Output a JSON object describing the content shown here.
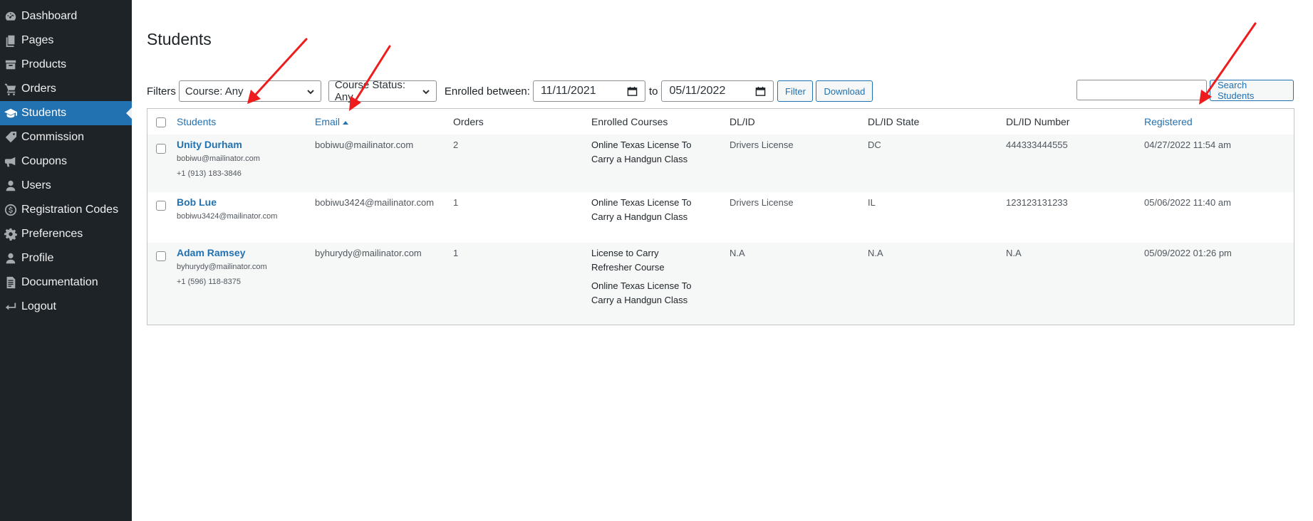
{
  "sidebar": {
    "items": [
      {
        "label": "Dashboard",
        "icon": "dashboard-icon"
      },
      {
        "label": "Pages",
        "icon": "pages-icon"
      },
      {
        "label": "Products",
        "icon": "archive-icon"
      },
      {
        "label": "Orders",
        "icon": "cart-icon"
      },
      {
        "label": "Students",
        "icon": "graduation-cap-icon"
      },
      {
        "label": "Commission",
        "icon": "tag-icon"
      },
      {
        "label": "Coupons",
        "icon": "megaphone-icon"
      },
      {
        "label": "Users",
        "icon": "user-icon"
      },
      {
        "label": "Registration Codes",
        "icon": "dollar-icon"
      },
      {
        "label": "Preferences",
        "icon": "gear-icon"
      },
      {
        "label": "Profile",
        "icon": "user-icon"
      },
      {
        "label": "Documentation",
        "icon": "document-icon"
      },
      {
        "label": "Logout",
        "icon": "return-icon"
      }
    ],
    "active_index": 4,
    "colors": {
      "bg": "#1d2327",
      "active": "#2271b1"
    }
  },
  "page": {
    "title": "Students"
  },
  "filters": {
    "label": "Filters",
    "course_select": "Course: Any",
    "status_select": "Course Status: Any",
    "enrolled_label": "Enrolled between:",
    "date_from": "11/11/2021",
    "to_label": "to",
    "date_to": "05/11/2022",
    "filter_button": "Filter",
    "download_button": "Download"
  },
  "search": {
    "value": "",
    "button": "Search Students"
  },
  "table": {
    "columns": [
      "Students",
      "Email",
      "Orders",
      "Enrolled Courses",
      "DL/ID",
      "DL/ID State",
      "DL/ID Number",
      "Registered"
    ],
    "rows": [
      {
        "name": "Unity Durham",
        "email_sub": "bobiwu@mailinator.com",
        "phone": "+1 (913) 183-3846",
        "email": "bobiwu@mailinator.com",
        "orders": "2",
        "courses": [
          "Online Texas License To Carry a Handgun Class"
        ],
        "dl": "Drivers License",
        "state": "DC",
        "number": "444333444555",
        "registered": "04/27/2022 11:54 am"
      },
      {
        "name": "Bob Lue",
        "email_sub": "bobiwu3424@mailinator.com",
        "phone": "",
        "email": "bobiwu3424@mailinator.com",
        "orders": "1",
        "courses": [
          "Online Texas License To Carry a Handgun Class"
        ],
        "dl": "Drivers License",
        "state": "IL",
        "number": "123123131233",
        "registered": "05/06/2022 11:40 am"
      },
      {
        "name": "Adam Ramsey",
        "email_sub": "byhurydy@mailinator.com",
        "phone": "+1 (596) 118-8375",
        "email": "byhurydy@mailinator.com",
        "orders": "1",
        "courses": [
          "License to Carry Refresher Course",
          "Online Texas License To Carry a Handgun Class"
        ],
        "dl": "N.A",
        "state": "N.A",
        "number": "N.A",
        "registered": "05/09/2022 01:26 pm"
      }
    ]
  },
  "annotation": {
    "arrow_color": "#ee1c1c"
  }
}
